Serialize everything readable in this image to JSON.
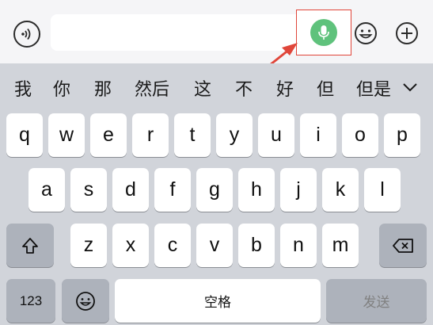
{
  "candidates": [
    "我",
    "你",
    "那",
    "然后",
    "这",
    "不",
    "好",
    "但",
    "但是"
  ],
  "keyboard": {
    "row1": [
      "q",
      "w",
      "e",
      "r",
      "t",
      "y",
      "u",
      "i",
      "o",
      "p"
    ],
    "row2": [
      "a",
      "s",
      "d",
      "f",
      "g",
      "h",
      "j",
      "k",
      "l"
    ],
    "row3": [
      "z",
      "x",
      "c",
      "v",
      "b",
      "n",
      "m"
    ],
    "numbers_label": "123",
    "space_label": "空格",
    "send_label": "发送"
  },
  "icons": {
    "voice_toggle": "voice-wave-icon",
    "mic": "microphone-icon",
    "emoji": "emoji-icon",
    "plus": "plus-circle-icon",
    "expand": "chevron-down-icon",
    "shift": "shift-icon",
    "backspace": "backspace-icon",
    "keyboard_emoji": "emoji-icon"
  },
  "colors": {
    "mic_green": "#5fc27c",
    "highlight_red": "#e0463a",
    "keyboard_bg": "#d1d4da"
  }
}
